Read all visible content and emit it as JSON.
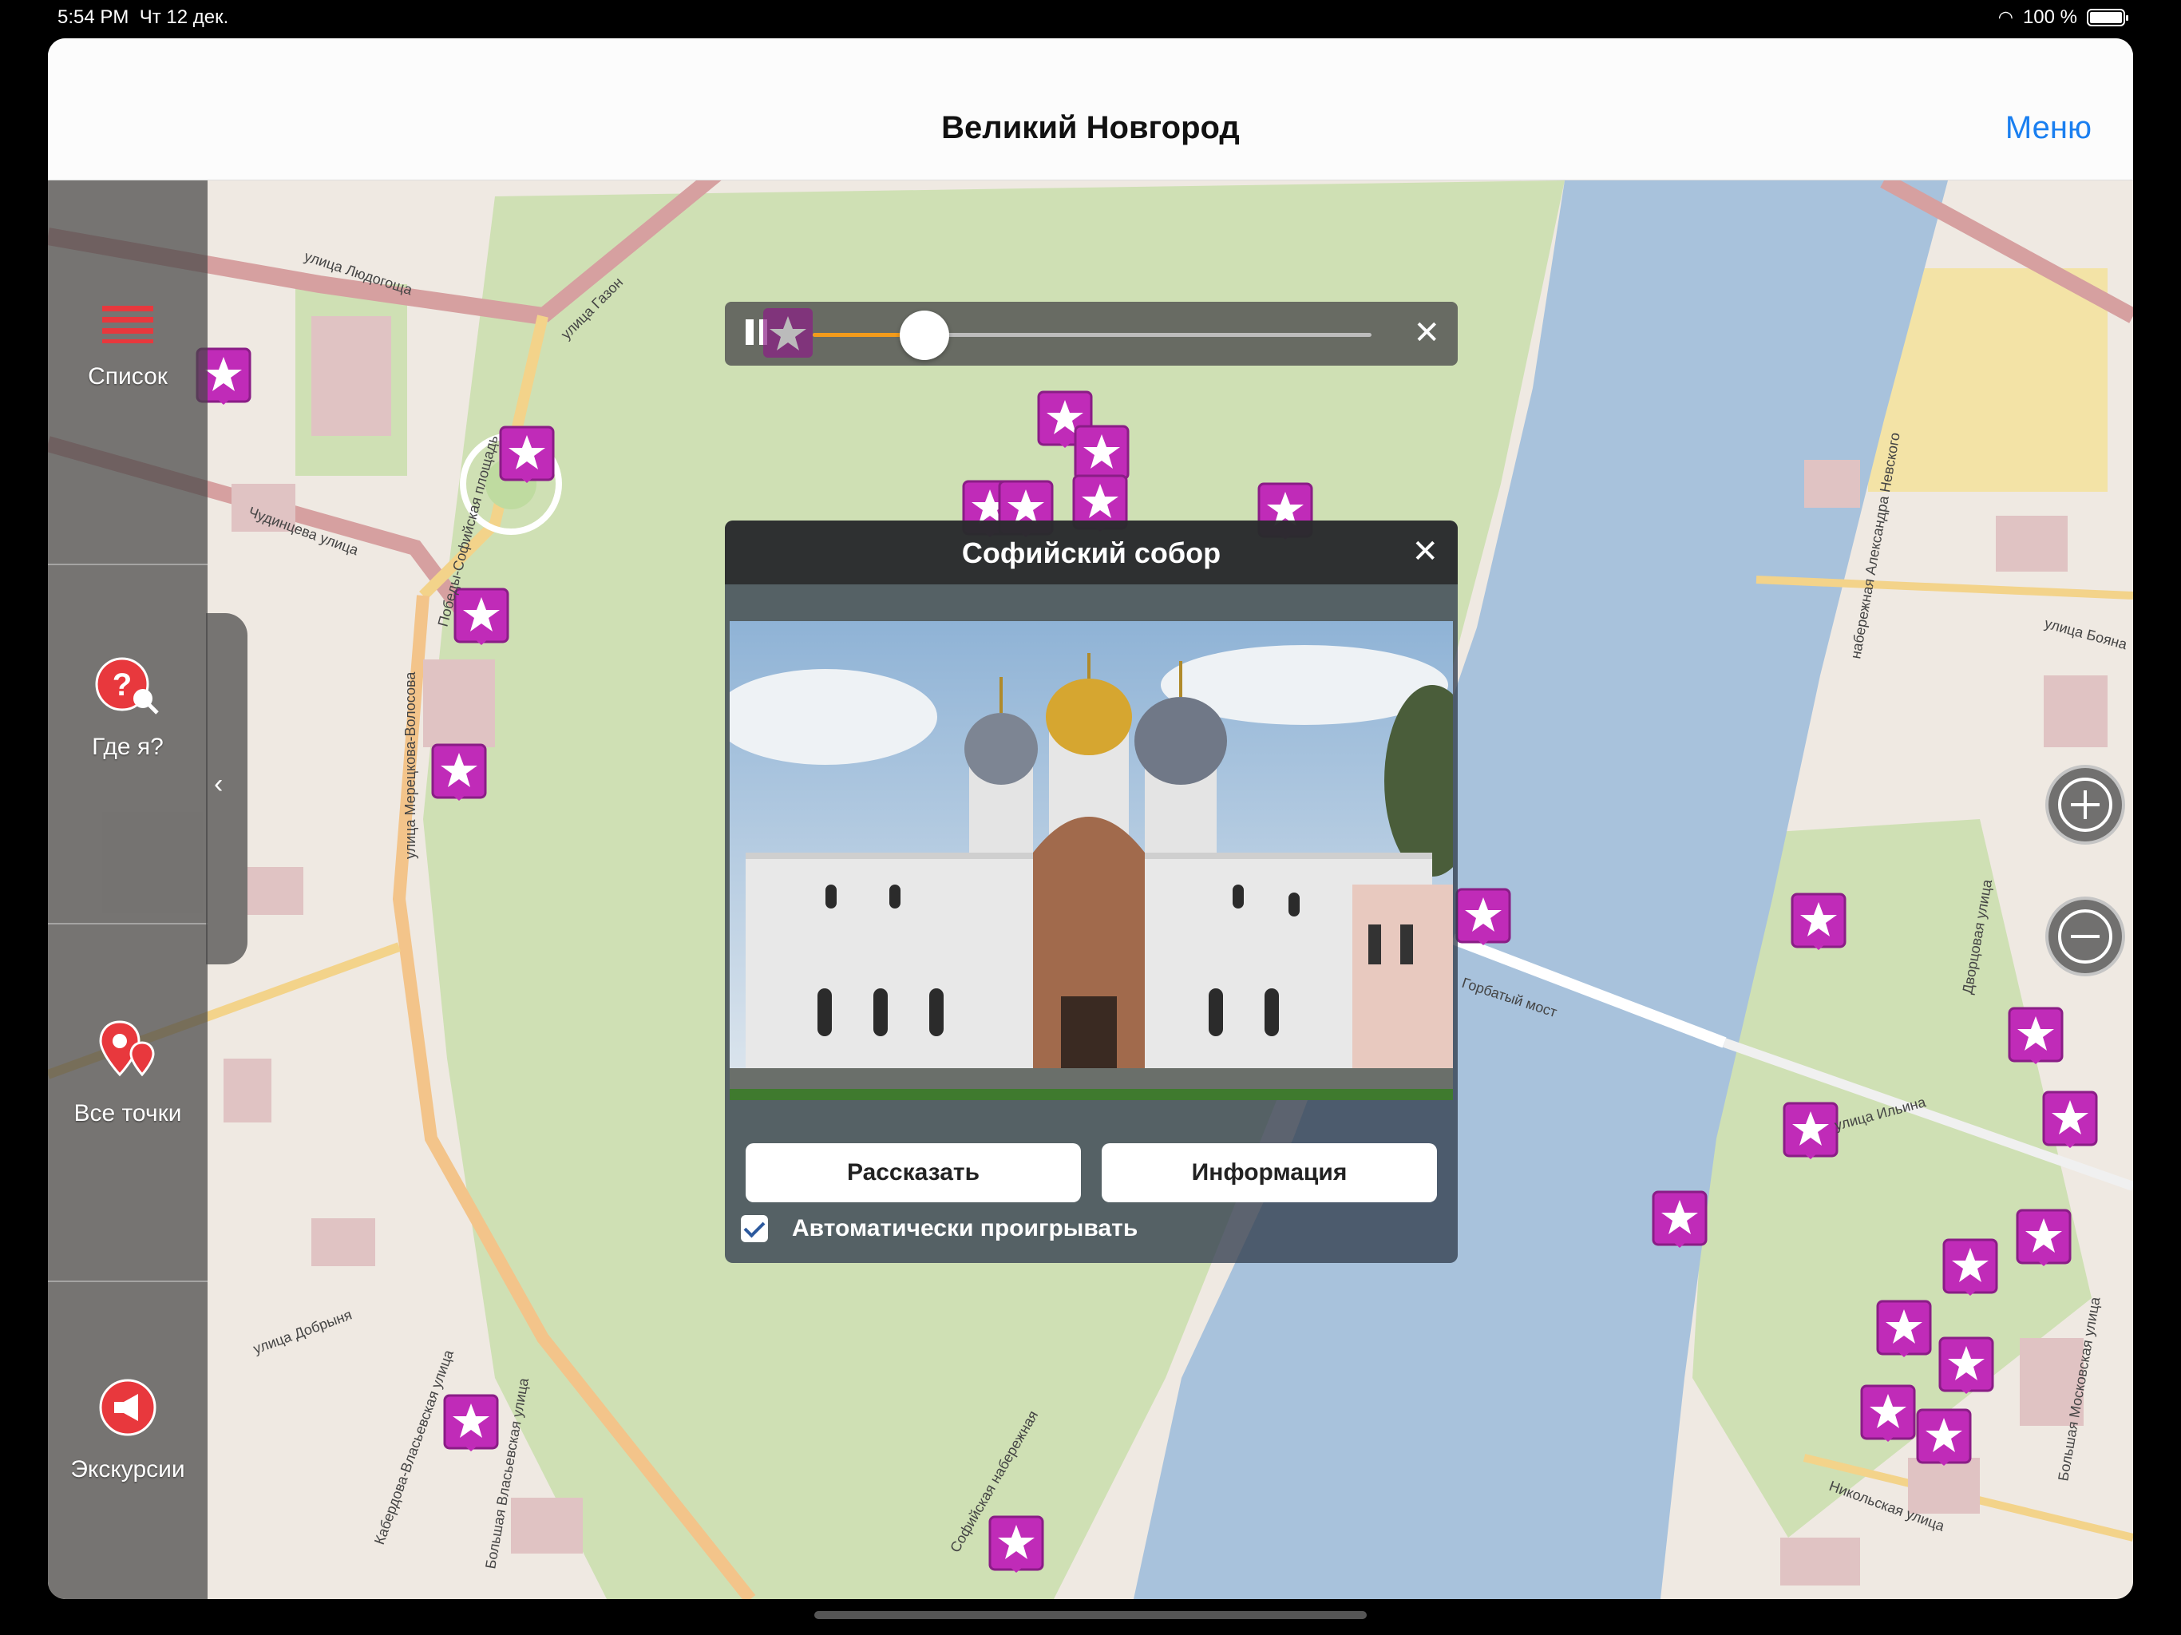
{
  "status_bar": {
    "time": "5:54 PM",
    "date": "Чт 12 дек.",
    "battery": "100 %"
  },
  "navbar": {
    "title": "Великий Новгород",
    "menu_label": "Меню"
  },
  "sidebar": {
    "list_label": "Список",
    "where_label": "Где я?",
    "all_points_label": "Все точки",
    "excursions_label": "Экскурсии"
  },
  "player": {
    "progress": 0.2
  },
  "popup": {
    "title": "Софийский собор",
    "tell_button": "Рассказать",
    "info_button": "Информация",
    "autoplay_label": "Автоматически проигрывать",
    "autoplay_checked": true
  },
  "map_labels": {
    "street_1": "улица Людогоща",
    "street_2": "улица Газон",
    "street_3": "Чудинцева улица",
    "street_4": "Победы-Софийская площадь",
    "street_5": "улица Мерецкова-Волосова",
    "street_6": "улица Добрыня",
    "street_7": "Горбатый мост",
    "street_8": "улица Ильина",
    "street_9": "Никольская улица",
    "street_10": "Софийская набережная",
    "street_11": "Большая Московская улица",
    "street_12": "набережная Александра Невского",
    "street_13": "Дворцовая улица",
    "street_14": "улица Бояна",
    "street_15": "Кабердова-Власьевская улица",
    "street_16": "Большая Власьевская улица"
  },
  "colors": {
    "accent": "#1a7ff0",
    "pin": "#c02bb8",
    "river": "#a8c2dc",
    "park": "#cfe0b4"
  }
}
